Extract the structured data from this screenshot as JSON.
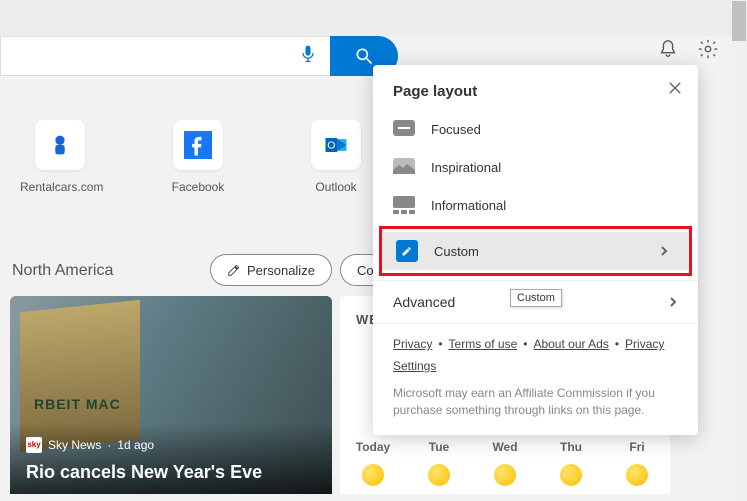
{
  "tiles": [
    {
      "label": "Rentalcars.com"
    },
    {
      "label": "Facebook"
    },
    {
      "label": "Outlook"
    }
  ],
  "section_title": "North America",
  "personalize_label": "Personalize",
  "con_label": "Con",
  "news": {
    "source": "Sky News",
    "time": "1d ago",
    "title": "Rio cancels New Year's Eve"
  },
  "weather": {
    "label": "WE",
    "days": [
      "Today",
      "Tue",
      "Wed",
      "Thu",
      "Fri"
    ]
  },
  "flyout": {
    "title": "Page layout",
    "options": [
      "Focused",
      "Inspirational",
      "Informational",
      "Custom"
    ],
    "advanced_label": "Advanced",
    "links": [
      "Privacy",
      "Terms of use",
      "About our Ads",
      "Privacy Settings"
    ],
    "disclaimer": "Microsoft may earn an Affiliate Commission if you purchase something through links on this page."
  },
  "tooltip": "Custom"
}
